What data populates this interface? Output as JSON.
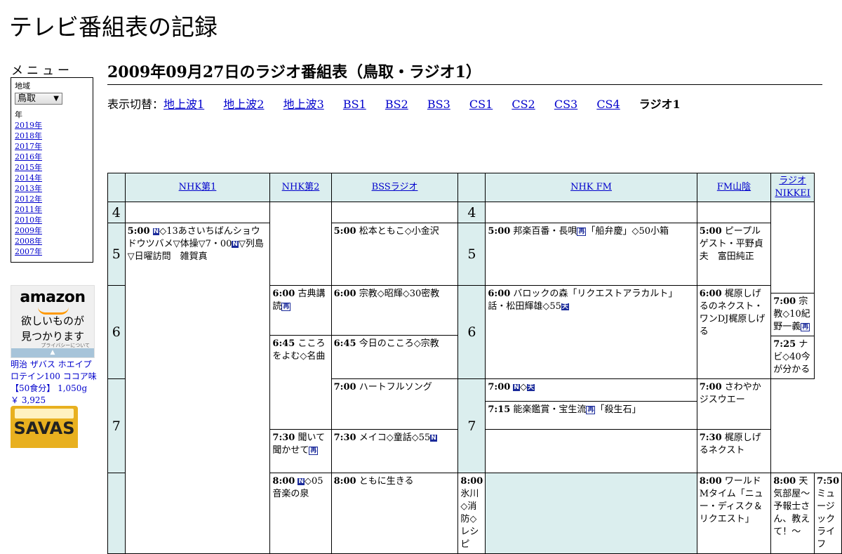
{
  "site_title": "テレビ番組表の記録",
  "menu": {
    "title": "メニュー",
    "region_label": "地域",
    "region_value": "鳥取",
    "year_label": "年",
    "years": [
      "2019年",
      "2018年",
      "2017年",
      "2016年",
      "2015年",
      "2014年",
      "2013年",
      "2012年",
      "2011年",
      "2010年",
      "2009年",
      "2008年",
      "2007年"
    ]
  },
  "ad": {
    "logo": "amazon",
    "tagline_1": "欲しいものが",
    "tagline_2": "見つかります",
    "privacy": "プライバシーについて",
    "collapse": "▲",
    "product_name": "明治 ザバス ホエイプロテイン100 ココア味【50食分】 1,050g",
    "price": "￥ 3,925",
    "product_brand": "SAVAS"
  },
  "heading": "2009年09月27日のラジオ番組表（鳥取・ラジオ1）",
  "switcher": {
    "label": "表示切替：",
    "links": [
      "地上波1",
      "地上波2",
      "地上波3",
      "BS1",
      "BS2",
      "BS3",
      "CS1",
      "CS2",
      "CS3",
      "CS4"
    ],
    "current": "ラジオ1"
  },
  "channels": [
    "NHK第1",
    "NHK第2",
    "BSSラジオ",
    "NHK FM",
    "FM山陰",
    "ラジオNIKKEI"
  ],
  "hours": [
    "4",
    "5",
    "6",
    "7"
  ],
  "programs": {
    "nhk1_500_time": "5:00",
    "nhk1_500_title": "◇13あさいちばんショウドウツバメ▽体操▽7・00",
    "nhk1_500_title2": "▽列島▽日曜訪問　雑賀真",
    "nhk1_800_time": "8:00",
    "nhk1_800_title": "◇05音楽の泉",
    "nhk2_600_time": "6:00",
    "nhk2_600_title": "古典講読",
    "nhk2_645_time": "6:45",
    "nhk2_645_title": "こころをよむ◇名曲",
    "nhk2_730_time": "7:30",
    "nhk2_730_title": "聞いて聞かせて",
    "nhk2_800_time": "8:00",
    "nhk2_800_title": "ともに生きる",
    "bss_500_time": "5:00",
    "bss_500_title": "松本ともこ◇小金沢",
    "bss_600_time": "6:00",
    "bss_600_title": "宗教◇昭輝◇30密教",
    "bss_645_time": "6:45",
    "bss_645_title": "今日のこころ◇宗教",
    "bss_700_time": "7:00",
    "bss_700_title": "ハートフルソング",
    "bss_730_time": "7:30",
    "bss_730_title": "メイコ◇童話◇55",
    "bss_800_time": "8:00",
    "bss_800_title": "氷川◇消防◇レシピ",
    "fm_500_time": "5:00",
    "fm_500_title": "邦楽百番・長唄",
    "fm_500_title2": "「船弁慶」◇50小箱",
    "fm_600_time": "6:00",
    "fm_600_title": "バロックの森「リクエストアラカルト」話・松田輝雄◇55",
    "fm_700_time": "7:00",
    "fm_700_title": "◇",
    "fm_715_time": "7:15",
    "fm_715_title": "能楽鑑賞・宝生流",
    "fm_715_title2": "「殺生石」",
    "fm_800_time": "8:00",
    "fm_800_title": "ワールドMタイム「ニュー・ディスク＆リクエスト」",
    "san_500_time": "5:00",
    "san_500_title": "ピープルゲスト・平野貞夫　富田純正",
    "san_600_time": "6:00",
    "san_600_title": "梶原しげるのネクスト・ワンDJ梶原しげる",
    "san_700_time": "7:00",
    "san_700_title": "さわやかジスウエー",
    "san_730_time": "7:30",
    "san_730_title": "梶原しげるネクスト",
    "san_800_time": "8:00",
    "san_800_title": "天気部屋～予報士さん、教えて！～",
    "nik_700_time": "7:00",
    "nik_700_title": "宗教◇10紀野一義",
    "nik_725_time": "7:25",
    "nik_725_title": "ナビ◇40今が分かる",
    "nik_750_time": "7:50",
    "nik_750_title": "ミュージックライフ"
  },
  "tags": {
    "n": "N",
    "re": "再",
    "ten": "天"
  }
}
